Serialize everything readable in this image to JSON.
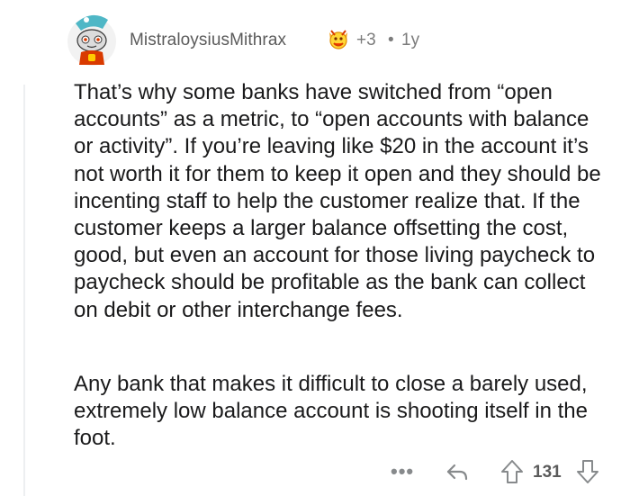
{
  "comment": {
    "username": "MistraloysiusMithrax",
    "award_count": "+3",
    "separator": "•",
    "age": "1y",
    "paragraphs": [
      "That’s why some banks have switched from “open accounts” as a metric, to “open accounts with balance or activity”. If you’re leaving like $20 in the account it’s not worth it for them to keep it open and they should be incenting staff to help the customer realize that. If the customer keeps a larger balance offsetting the cost, good, but even an account for those living paycheck to paycheck should be profitable as the bank can collect on debit or other interchange fees.",
      "Any bank that makes it difficult to close a barely used, extremely low balance account is shooting itself in the foot."
    ]
  },
  "actions": {
    "more_label": "•••",
    "vote_count": "131"
  },
  "icons": {
    "avatar": "snoo-avatar",
    "award": "award-icon",
    "reply": "reply-icon",
    "upvote": "upvote-icon",
    "downvote": "downvote-icon"
  },
  "colors": {
    "text": "#1a1a1b",
    "meta": "#7c7c7c",
    "icon": "#878a8c"
  }
}
